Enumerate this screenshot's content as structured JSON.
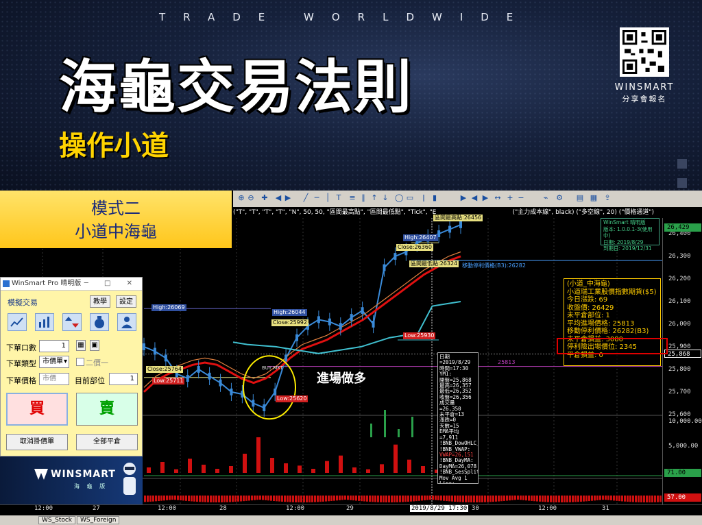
{
  "banner": {
    "tagline": "TRADE WORLDWIDE",
    "title": "海龜交易法則",
    "subtitle": "操作小道",
    "qr_brand": "WINSMART",
    "qr_sub": "分享會報名"
  },
  "mode": {
    "line1": "模式二",
    "line2": "小道中海龜"
  },
  "panel": {
    "window_title": "WinSmart Pro 晴明版",
    "window_controls": "─ □ ✕",
    "sim_label": "模擬交易",
    "teach_button": "教學",
    "settings_button": "設定",
    "qty_label": "下單口數",
    "qty_value": "1",
    "order_type_label": "下單類型",
    "order_type_value": "市價單",
    "second_order_label": "二價一",
    "price_label": "下單價格",
    "price_value": "市價",
    "position_label": "目前部位",
    "position_value": "1",
    "buy_label": "買",
    "sell_label": "賣",
    "cancel_button": "取消掛價單",
    "close_all_button": "全部平倉",
    "logo_text": "WINSMART",
    "logo_sub": "海 龜 版"
  },
  "toolbar": {
    "params": "(\"T\", \"T\", \"T\", \"T\", \"N\", 50, 50, \"區間最高點\", \"區間最低點\", \"Tick\", \"E",
    "params_right": "(\"主力成本線\", black) (\"多空線\", 20) (\"價格通道\")"
  },
  "price_axis": {
    "ticks": [
      "26,400",
      "26,300",
      "26,200",
      "26,100",
      "26,000",
      "25,900",
      "25,800",
      "25,700",
      "25,600"
    ],
    "badge_top": "26,429",
    "badge_current": "25,868",
    "vol_ticks": [
      "10,000.00",
      "5,000.00"
    ],
    "indicator_1": "71.00",
    "indicator_2": "57.00"
  },
  "time_axis": {
    "labels": [
      "12:00",
      "27",
      "12:00",
      "28",
      "12:00",
      "29",
      "2019/8/29 17:30",
      "30",
      "12:00",
      "31"
    ]
  },
  "bottom_tabs": [
    "WS_Stock",
    "WS_Foreign"
  ],
  "chart_labels": {
    "high_left": "High:26069",
    "close_left": "Close:25764",
    "low_left": "Low:25711",
    "high_mid": "High:26044",
    "close_mid": "Close:25992",
    "low_mid": "Low:25620",
    "low_right": "Low:25930",
    "high_top": "High:26407",
    "close_top": "Close:26360",
    "range_high": "區間最高點:26456",
    "range_low": "區間最低點:26324",
    "trail_stop": "移動停利價格(B3):26282",
    "purple_level": "25813",
    "entry_mark": "BUY MKT",
    "entry_note": "進場做多"
  },
  "info_box": {
    "lines": [
      "(小道_中海龜)",
      "小道瑞工業股價指數期貨($5)",
      "今日漲跌: 69",
      "收盤價: 26429",
      "未平倉部位: 1",
      "平均進場價格: 25813",
      "移動停利價格: 26282(B3)",
      "未平倉損益: 3080",
      "停利險出場價位: 2345",
      "平倉損益: 0"
    ]
  },
  "wm_box": {
    "lines": [
      "WinSmart 晴明版",
      "版本: 1.0.0.1-3(使用中)",
      "日期: 2019/8/29",
      "到期日: 2019/12/31"
    ]
  },
  "data_window": {
    "lines": [
      "日期=2019/8/29",
      "時間=17:30",
      "YM1:",
      "開盤=25,868",
      "最高=26,357",
      "最低=26,352",
      "收盤=26,356",
      "成交量=26,350",
      "未平倉=13",
      "漲跌=0",
      "天數=15",
      "",
      "EMA平均=7,911",
      "!BNB_DowOHLC_vl:",
      "!BNB_VWAP:",
      "VWAP=26,151",
      "!BNB_DayMA:",
      "DayMA=26,078",
      "!BNB_SesSplit:",
      "Mov Avg 1 Line:",
      "Avg=26,237"
    ]
  },
  "chart_data": {
    "type": "candlestick",
    "title": "",
    "xlabel": "",
    "ylabel": "",
    "ylim": [
      25560,
      26470
    ],
    "x": [
      "27",
      "28",
      "29",
      "2019/8/29 17:30"
    ],
    "series": [
      {
        "values": [
          25900,
          25880,
          25850,
          25780,
          25760,
          25800,
          25770,
          25740,
          25700,
          25690,
          25650,
          25630,
          25700,
          25850,
          25940,
          25990,
          26020,
          26010,
          25990,
          26030,
          26060,
          26000,
          26250,
          26300,
          26320,
          26360,
          26380,
          26400,
          26420,
          26440
        ]
      },
      {
        "values": [
          25700,
          25750,
          25780,
          25800,
          25820,
          25830,
          25820,
          25790,
          25760,
          25740,
          25760,
          25800,
          25850,
          25890,
          25910,
          25930,
          25960,
          25990,
          26020,
          26060,
          26100,
          26140,
          26180,
          26220,
          26250,
          26280,
          26300
        ]
      },
      {
        "values": [
          25920,
          25910,
          25905,
          25900,
          25890,
          25880,
          25870,
          25880,
          25890,
          25900,
          25920,
          25940,
          25950,
          25960,
          26080,
          26090,
          26100
        ]
      }
    ],
    "volume": [
      1200,
      2400,
      800,
      3100,
      1800,
      900,
      1500,
      4200,
      7800,
      3300,
      2100,
      1600,
      900,
      2600,
      3800,
      1200,
      800,
      1900,
      6200,
      2900,
      1500,
      700
    ],
    "colors": {
      "price": "#3a8ad8",
      "ma_red": "#e01010",
      "ma_orange": "#e08040",
      "channel": "#40c0d0",
      "volume": "#d01010"
    }
  }
}
